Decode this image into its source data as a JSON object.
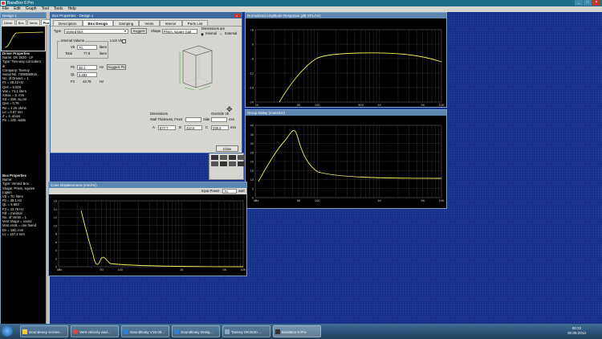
{
  "app": {
    "title": "BassBox 6 Pro"
  },
  "menu": [
    "File",
    "Edit",
    "Graph",
    "Tool",
    "Tools",
    "Help"
  ],
  "design_window": {
    "title": "Design 1",
    "tabs": [
      "Driver",
      "Box",
      "Vents",
      "Plot"
    ],
    "driver_header": "Driver Properties",
    "driver_lines": [
      "Name: DK 2520 - LF",
      "Type: Two-way coincident dr",
      "Company: Tannoy",
      "Serial No: 7389056915...",
      "No. of Drivers = 1",
      "Fs = 38.22 Hz",
      "Qes = 9.029",
      "Vas = 74.1 liters",
      "Xmax = 5. mm",
      "Sd = 256. sq.cm",
      "Qes = 0.76",
      "Re = 4.25 ohms",
      "Le = 0.87 mH",
      "Z = 4. ohms",
      "Pe = 100. watts"
    ],
    "box_header": "Box Properties",
    "box_lines": [
      "Name:",
      "Type: Vented Box",
      "Shape: Prism, square (optim",
      "Vb = 70. liters",
      "Fb = 38.1 Hz",
      "QL = 6.693",
      "F3 = 43.76 Hz",
      "Fill = minimal",
      "No. of Vents = 1",
      "Vent shape = round",
      "Vent ends = one flared",
      "Dv = 180. mm",
      "Lv = 197.2 mm"
    ]
  },
  "box_props": {
    "title": "Box Properties - Design 1",
    "tabs": [
      "Description",
      "Box Design",
      "Damping",
      "Vents",
      "Interior",
      "Parts List"
    ],
    "type_label": "Type",
    "type_value": "Vented Box",
    "suggest_btn": "Suggest",
    "shape_label": "Shape",
    "shape_value": "Prism, square (opt",
    "dimensions_label": "Dimensions are",
    "internal_label": "Internal",
    "external_label": "External",
    "internal_volume_label": "Internal Volume",
    "lock_vb_label": "Lock Vb",
    "vb_label": "Vb",
    "vb_value": "70.",
    "vb_unit": "liters",
    "total_label": "Total",
    "total_value": "77.8",
    "total_unit": "liters",
    "fb_label": "Fb",
    "fb_value": "38.1",
    "fb_unit": "Hz",
    "suggest_fb_btn": "Suggest Fb",
    "ql_label": "QL",
    "ql_value": "6.693",
    "f3_label": "F3",
    "f3_value": "43.76",
    "f3_unit": "Hz",
    "dims_header": "Dimensions",
    "wall_label": "Wall Thickness, Front",
    "side_label": "Side",
    "mm_unit": "mm",
    "override_label": "Override Vb",
    "a_label": "A",
    "a_value": "677.7",
    "b_label": "B",
    "b_value": "410.8",
    "c_label": "C",
    "c_value": "258.9",
    "close_btn": "Close"
  },
  "amp_window": {
    "title": "Normalized Amplitude Response (dB SPL/Hz)",
    "y_ticks": [
      "+6",
      "0",
      "-6",
      "-12",
      "-18",
      "-24"
    ],
    "x_ticks": [
      "10",
      "50",
      "100",
      "500",
      "1K",
      "5K",
      "10K"
    ],
    "x_tick_pos": [
      0.0,
      0.233,
      0.333,
      0.567,
      0.667,
      0.9,
      1.0
    ]
  },
  "group_window": {
    "title": "Group Delay (msec/Hz)",
    "y_ticks": [
      "40",
      "35",
      "30",
      "25",
      "20",
      "15",
      "10",
      "5",
      "0"
    ],
    "x_ticks": [
      "Hz",
      "10",
      "50",
      "100",
      "1K",
      "5K",
      "10K"
    ],
    "x_tick_pos": [
      0.0,
      0.0,
      0.233,
      0.333,
      0.667,
      0.9,
      1.0
    ]
  },
  "cone_window": {
    "title": "Cone Displacement (mm/Hz)",
    "input_power_label": "Input Power",
    "input_power_value": "70.",
    "input_power_unit": "watt",
    "y_ticks": [
      "16",
      "14",
      "12",
      "10",
      "8",
      "6",
      "4",
      "2",
      "0"
    ],
    "x_ticks": [
      "Hz",
      "10",
      "50",
      "100",
      "1K",
      "5K",
      "10K"
    ],
    "x_tick_pos": [
      0.0,
      0.0,
      0.233,
      0.333,
      0.667,
      0.9,
      1.0
    ]
  },
  "taskbar": {
    "items": [
      "Soundeasy screen...",
      "Vent velocity and...",
      "SoundEasy V19.00...",
      "SoundEasy Desig...",
      "Tannoy DK2520 ...",
      "BassBox 6 Pro"
    ],
    "time": "00:22",
    "date": "30.05.2014"
  },
  "colors": {
    "trace": "#f2f25a",
    "grid": "#3c3c3c",
    "desktop": "#17318a"
  }
}
